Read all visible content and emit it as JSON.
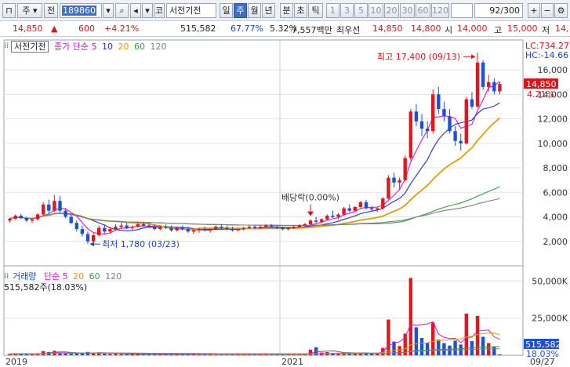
{
  "toolbar": {
    "mode": "주",
    "prefix": "전",
    "code": "189860",
    "name_prefix": "코",
    "name": "서전기전",
    "periods": [
      "일",
      "주",
      "월",
      "년",
      "분",
      "초",
      "틱"
    ],
    "selected_period": "주",
    "intervals": [
      "1",
      "3",
      "5",
      "10",
      "20",
      "30",
      "60",
      "120"
    ],
    "count": "92/300"
  },
  "quote": {
    "price": "14,850",
    "change_arrow": "▲",
    "change": "600",
    "change_pct": "+4.21%",
    "volume": "515,582",
    "volume_ratio": "67.77%",
    "turnover": "5.32%",
    "amount": "7,557백만",
    "best_label": "최우선",
    "ask": "14,850",
    "bid": "14,800",
    "open_label": "시",
    "open": "14,000",
    "high_label": "고",
    "high": "15,000",
    "low_label": "저",
    "low": "14,"
  },
  "price_panel": {
    "title": "서전기전",
    "legend_label": "종가 단순",
    "ma_periods": [
      "5",
      "10",
      "20",
      "60",
      "120"
    ],
    "ma_colors": [
      "#e010e0",
      "#2030d0",
      "#e0a000",
      "#30a040",
      "#808080"
    ],
    "lc_label": "LC:734.27",
    "hc_label": "HC:-14.66",
    "current_price": "14,850",
    "current_pct": "4.21%",
    "high_annot": "최고 17,400 (09/13)",
    "low_annot": "최저 1,780 (03/23)",
    "dividend_annot": "배당락(0.00%)",
    "y_ticks": [
      "16,000",
      "14,000",
      "12,000",
      "10,000",
      "8,000",
      "6,000",
      "4,000",
      "2,000"
    ]
  },
  "volume_panel": {
    "legend_label": "거래량",
    "legend_ma": "단순",
    "ma_periods": [
      "5",
      "20",
      "60",
      "120"
    ],
    "value_label": "515,582주(18.03%)",
    "current_vol": "515,582",
    "current_pct": "18.03%",
    "y_ticks": [
      "50,000K",
      "25,000K"
    ]
  },
  "x_axis": {
    "labels": [
      "2019",
      "2021"
    ],
    "right_label": "09/27"
  },
  "chart_data": {
    "type": "candlestick",
    "y_range": [
      0,
      17800
    ],
    "vol_range": [
      0,
      57000
    ],
    "up_color": "#e8141c",
    "down_color": "#1f4fd8",
    "candles": [
      [
        3700,
        3950,
        3550,
        3850,
        900
      ],
      [
        3850,
        4200,
        3750,
        4100,
        1100
      ],
      [
        4100,
        4250,
        3800,
        3900,
        800
      ],
      [
        3900,
        4000,
        3600,
        3700,
        700
      ],
      [
        3700,
        3900,
        3500,
        3800,
        750
      ],
      [
        3800,
        4300,
        3700,
        4200,
        1300
      ],
      [
        4200,
        5200,
        4100,
        5000,
        2800
      ],
      [
        5000,
        5400,
        4200,
        4500,
        2200
      ],
      [
        4500,
        5800,
        4400,
        5300,
        3000
      ],
      [
        5300,
        5700,
        4300,
        4500,
        1800
      ],
      [
        4500,
        4700,
        3900,
        4000,
        1200
      ],
      [
        4000,
        4200,
        3400,
        3500,
        1000
      ],
      [
        3500,
        3700,
        2800,
        3000,
        1300
      ],
      [
        3000,
        3300,
        2400,
        2600,
        1500
      ],
      [
        2600,
        2800,
        1780,
        2000,
        2200
      ],
      [
        2000,
        2700,
        1800,
        2500,
        1600
      ],
      [
        2500,
        3300,
        2400,
        3100,
        1900
      ],
      [
        3100,
        3400,
        2600,
        2800,
        1100
      ],
      [
        2800,
        3200,
        2700,
        3000,
        900
      ],
      [
        3000,
        3400,
        2900,
        3200,
        1000
      ],
      [
        3200,
        3500,
        3000,
        3300,
        800
      ],
      [
        3300,
        3500,
        3000,
        3100,
        700
      ],
      [
        3100,
        3300,
        2900,
        3200,
        650
      ],
      [
        3200,
        3600,
        3100,
        3400,
        900
      ],
      [
        3400,
        3600,
        3200,
        3300,
        700
      ],
      [
        3300,
        3500,
        3100,
        3200,
        650
      ],
      [
        3200,
        3400,
        2900,
        3000,
        600
      ],
      [
        3000,
        3300,
        2900,
        3200,
        700
      ],
      [
        3200,
        3400,
        3000,
        3100,
        600
      ],
      [
        3100,
        3300,
        2800,
        2900,
        650
      ],
      [
        2900,
        3200,
        2800,
        3100,
        700
      ],
      [
        3100,
        3300,
        2900,
        3000,
        600
      ],
      [
        3000,
        3200,
        2700,
        2800,
        700
      ],
      [
        2800,
        3000,
        2600,
        2900,
        650
      ],
      [
        2900,
        3100,
        2700,
        3000,
        600
      ],
      [
        3000,
        3200,
        2800,
        2900,
        550
      ],
      [
        2900,
        3100,
        2700,
        3000,
        600
      ],
      [
        3000,
        3300,
        2900,
        3200,
        700
      ],
      [
        3200,
        3400,
        3000,
        3100,
        600
      ],
      [
        3100,
        3300,
        2900,
        3000,
        550
      ],
      [
        3000,
        3200,
        2800,
        2900,
        600
      ],
      [
        2900,
        3100,
        2800,
        3000,
        550
      ],
      [
        3000,
        3200,
        2900,
        3100,
        600
      ],
      [
        3100,
        3300,
        3000,
        3200,
        650
      ],
      [
        3200,
        3300,
        3000,
        3100,
        550
      ],
      [
        3100,
        3300,
        3000,
        3200,
        600
      ],
      [
        3200,
        3400,
        3100,
        3300,
        700
      ],
      [
        3300,
        3400,
        3100,
        3200,
        600
      ],
      [
        3200,
        3300,
        3000,
        3100,
        550
      ],
      [
        3100,
        3200,
        2900,
        3000,
        500
      ],
      [
        3000,
        3200,
        2900,
        3100,
        550
      ],
      [
        3100,
        3300,
        3000,
        3200,
        600
      ],
      [
        3200,
        3400,
        3100,
        3300,
        650
      ],
      [
        3300,
        3500,
        3200,
        3400,
        900
      ],
      [
        3400,
        3800,
        3300,
        3700,
        3800
      ],
      [
        3700,
        4000,
        3500,
        3600,
        5400
      ],
      [
        3600,
        3900,
        3500,
        3800,
        1800
      ],
      [
        3800,
        4200,
        3700,
        4100,
        2100
      ],
      [
        4100,
        4500,
        3900,
        4000,
        1500
      ],
      [
        4000,
        4300,
        3800,
        4200,
        1400
      ],
      [
        4200,
        4800,
        4100,
        4700,
        1900
      ],
      [
        4700,
        5000,
        4400,
        4500,
        1600
      ],
      [
        4500,
        4900,
        4400,
        4800,
        1300
      ],
      [
        4800,
        5300,
        4700,
        5200,
        1800
      ],
      [
        5200,
        5400,
        4600,
        4700,
        1700
      ],
      [
        4700,
        4900,
        4500,
        4600,
        1100
      ],
      [
        4600,
        4800,
        4400,
        4700,
        1000
      ],
      [
        4700,
        5600,
        4600,
        5500,
        4900
      ],
      [
        5500,
        7400,
        5400,
        7200,
        24000
      ],
      [
        7200,
        7600,
        6400,
        6800,
        9200
      ],
      [
        6800,
        7200,
        6200,
        7000,
        6200
      ],
      [
        7000,
        9000,
        6900,
        8800,
        14500
      ],
      [
        8800,
        12800,
        8600,
        12600,
        52000
      ],
      [
        12600,
        13200,
        11400,
        11800,
        18800
      ],
      [
        11800,
        12400,
        10600,
        11200,
        11600
      ],
      [
        11200,
        11800,
        10400,
        11000,
        8400
      ],
      [
        11000,
        14400,
        10800,
        14000,
        22000
      ],
      [
        14000,
        14600,
        12400,
        12800,
        10500
      ],
      [
        12800,
        13400,
        11800,
        12200,
        8200
      ],
      [
        12200,
        12800,
        10800,
        11000,
        6500
      ],
      [
        11000,
        11400,
        9800,
        10200,
        9800
      ],
      [
        10200,
        10800,
        9400,
        10000,
        7200
      ],
      [
        10000,
        13800,
        9900,
        13600,
        28000
      ],
      [
        13600,
        14200,
        12800,
        13000,
        9500
      ],
      [
        13000,
        17400,
        12900,
        16600,
        26500
      ],
      [
        16600,
        16800,
        14400,
        14600,
        12400
      ],
      [
        14600,
        15600,
        14200,
        15000,
        8200
      ],
      [
        15000,
        15300,
        14000,
        14250,
        5800
      ],
      [
        14250,
        15000,
        14000,
        14850,
        515
      ]
    ]
  }
}
